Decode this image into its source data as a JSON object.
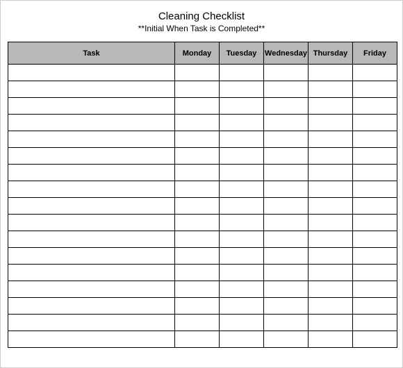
{
  "title": "Cleaning Checklist",
  "subtitle": "**Initial When Task is Completed**",
  "columns": [
    "Task",
    "Monday",
    "Tuesday",
    "Wednesday",
    "Thursday",
    "Friday"
  ],
  "rows": [
    [
      "",
      "",
      "",
      "",
      "",
      ""
    ],
    [
      "",
      "",
      "",
      "",
      "",
      ""
    ],
    [
      "",
      "",
      "",
      "",
      "",
      ""
    ],
    [
      "",
      "",
      "",
      "",
      "",
      ""
    ],
    [
      "",
      "",
      "",
      "",
      "",
      ""
    ],
    [
      "",
      "",
      "",
      "",
      "",
      ""
    ],
    [
      "",
      "",
      "",
      "",
      "",
      ""
    ],
    [
      "",
      "",
      "",
      "",
      "",
      ""
    ],
    [
      "",
      "",
      "",
      "",
      "",
      ""
    ],
    [
      "",
      "",
      "",
      "",
      "",
      ""
    ],
    [
      "",
      "",
      "",
      "",
      "",
      ""
    ],
    [
      "",
      "",
      "",
      "",
      "",
      ""
    ],
    [
      "",
      "",
      "",
      "",
      "",
      ""
    ],
    [
      "",
      "",
      "",
      "",
      "",
      ""
    ],
    [
      "",
      "",
      "",
      "",
      "",
      ""
    ],
    [
      "",
      "",
      "",
      "",
      "",
      ""
    ],
    [
      "",
      "",
      "",
      "",
      "",
      ""
    ]
  ]
}
